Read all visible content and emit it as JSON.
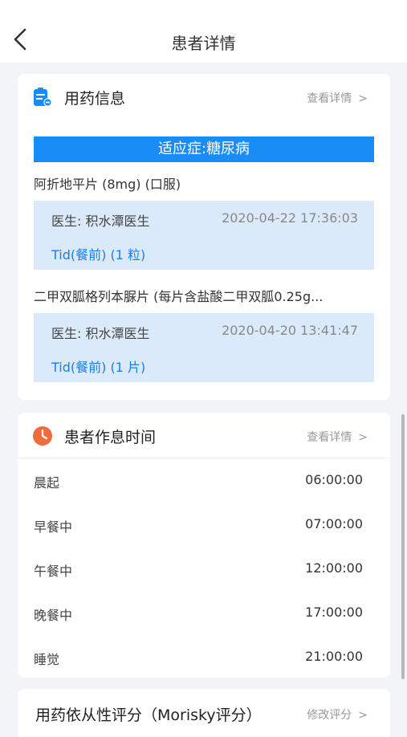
{
  "nav": {
    "title": "患者详情"
  },
  "medication": {
    "title": "用药信息",
    "detail_link": "查看详情",
    "chevron": ">",
    "indication": "适应症:糖尿病",
    "drugs": [
      {
        "name": "阿折地平片 (8mg) (口服)",
        "doctor": "医生: 积水潭医生",
        "time": "2020-04-22 17:36:03",
        "dose": "Tid(餐前) (1 粒)"
      },
      {
        "name": "二甲双胍格列本脲片 (每片含盐酸二甲双胍0.25g...",
        "doctor": "医生: 积水潭医生",
        "time": "2020-04-20 13:41:47",
        "dose": "Tid(餐前) (1 片)"
      }
    ]
  },
  "schedule": {
    "title": "患者作息时间",
    "detail_link": "查看详情",
    "chevron": ">",
    "rows": [
      {
        "label": "晨起",
        "time": "06:00:00"
      },
      {
        "label": "早餐中",
        "time": "07:00:00"
      },
      {
        "label": "午餐中",
        "time": "12:00:00"
      },
      {
        "label": "晚餐中",
        "time": "17:00:00"
      },
      {
        "label": "睡觉",
        "time": "21:00:00"
      }
    ]
  },
  "morisky": {
    "title": "用药依从性评分（Morisky评分）",
    "edit_link": "修改评分",
    "chevron": ">"
  },
  "colors": {
    "accent": "#1a8cf5",
    "dose_text": "#1a7ee8",
    "rx_bg": "#dbeafb",
    "clock": "#f26b3a"
  },
  "icons": {
    "back": "chevron-left-icon",
    "medication": "clipboard-pill-icon",
    "schedule": "clock-icon"
  }
}
